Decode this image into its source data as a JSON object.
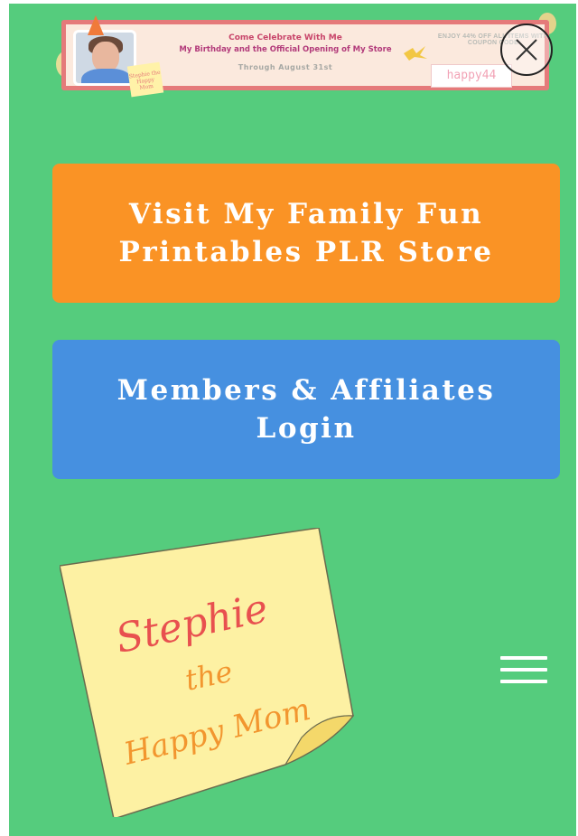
{
  "banner": {
    "line1": "Come Celebrate With Me",
    "line2": "My Birthday and the Official Opening of My Store",
    "line3": "Through August 31st",
    "offer_line1": "ENJOY 44% OFF ALL ITEMS WITH",
    "offer_line2": "COUPON CODE",
    "coupon_code": "happy44",
    "note_text": "Stephie the Happy Mom",
    "close_icon": "close-icon"
  },
  "buttons": {
    "store_label": "Visit My Family Fun Printables PLR Store",
    "login_label": "Members & Affiliates Login"
  },
  "logo": {
    "line1": "Stephie",
    "line2": "the",
    "line3": "Happy Mom"
  },
  "menu": {
    "icon": "hamburger-menu-icon"
  },
  "colors": {
    "background": "#55cc7d",
    "store_button": "#fa9325",
    "login_button": "#4690e0",
    "note": "#fdf1a3",
    "logo_red": "#e8504f",
    "logo_orange": "#f2962f"
  }
}
